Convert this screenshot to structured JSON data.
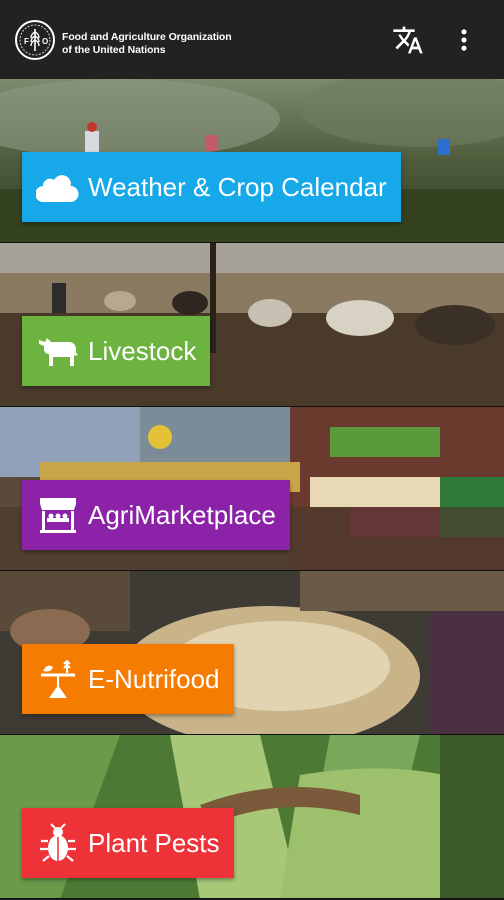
{
  "header": {
    "org_line1": "Food and Agriculture Organization",
    "org_line2": "of the United Nations",
    "logo_icon": "fao-logo-icon",
    "actions": [
      {
        "icon": "translate-icon"
      },
      {
        "icon": "more-vert-icon"
      }
    ]
  },
  "tiles": [
    {
      "label": "Weather & Crop Calendar",
      "icon": "cloud-icon",
      "color": "#16A8E8"
    },
    {
      "label": "Livestock",
      "icon": "cow-icon",
      "color": "#6DB33F"
    },
    {
      "label": "AgriMarketplace",
      "icon": "market-stall-icon",
      "color": "#8B22A8"
    },
    {
      "label": "E-Nutrifood",
      "icon": "nutrition-scale-icon",
      "color": "#F57C00"
    },
    {
      "label": "Plant Pests",
      "icon": "bug-icon",
      "color": "#EE3338"
    }
  ]
}
